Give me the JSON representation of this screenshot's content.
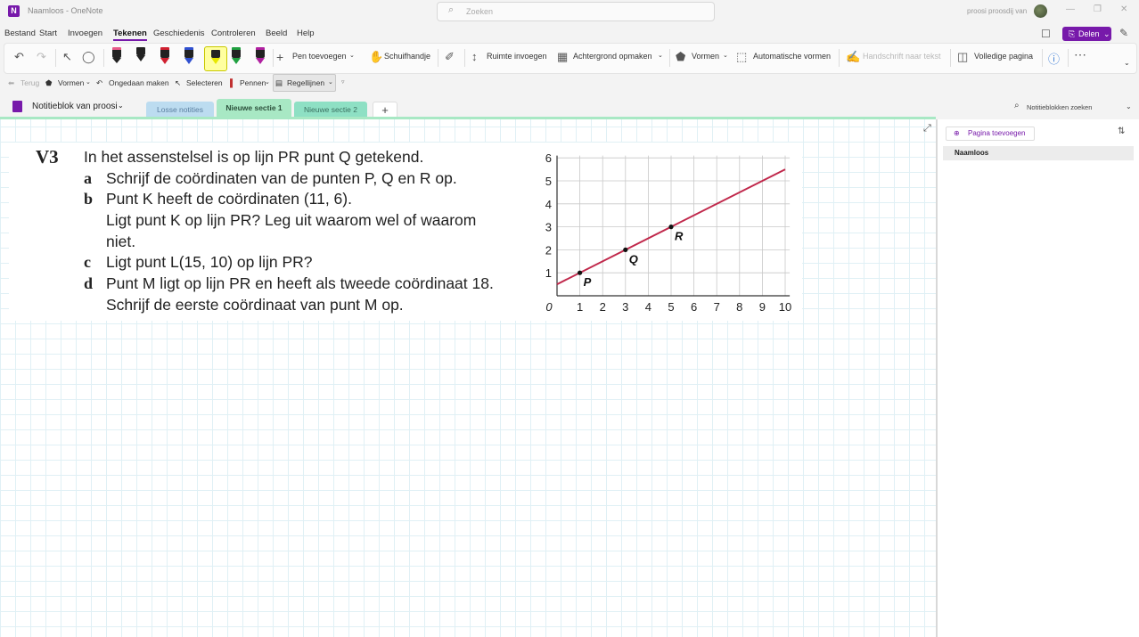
{
  "window": {
    "title": "Naamloos - OneNote",
    "user": "proosi proosdij van",
    "app_icon": "N"
  },
  "search": {
    "placeholder": "Zoeken"
  },
  "menu": [
    "Bestand",
    "Start",
    "Invoegen",
    "Tekenen",
    "Geschiedenis",
    "Controleren",
    "Beeld",
    "Help"
  ],
  "share_label": "Delen",
  "ribbon": {
    "add_pen": "Pen toevoegen",
    "hand": "Schuifhandje",
    "space": "Ruimte invoegen",
    "background": "Achtergrond opmaken",
    "shapes": "Vormen",
    "auto_shapes": "Automatische vormen",
    "ink_to_text": "Handschrift naar tekst",
    "full_page": "Volledige pagina"
  },
  "toolbar2": {
    "back": "Terug",
    "shapes": "Vormen",
    "undo": "Ongedaan maken",
    "select": "Selecteren",
    "pens": "Pennen",
    "rule_lines": "Regellijnen"
  },
  "notebook": {
    "name": "Notitieblok van proosi",
    "tabs": [
      "Losse notities",
      "Nieuwe sectie 1",
      "Nieuwe sectie 2"
    ],
    "add_tab": "+",
    "search_label": "Notitieblokken zoeken"
  },
  "pages": {
    "add_label": "Pagina toevoegen",
    "items": [
      "Naamloos"
    ]
  },
  "exercise": {
    "number": "V3",
    "intro": "In het assenstelsel is op lijn PR punt Q getekend.",
    "a_letter": "a",
    "a_text": "Schrijf de coördinaten van de punten P, Q en R op.",
    "b_letter": "b",
    "b_text1": "Punt K heeft de coördinaten (11, 6).",
    "b_text2": "Ligt punt K op lijn PR? Leg uit waarom wel of waarom",
    "b_text3": "niet.",
    "c_letter": "c",
    "c_text": "Ligt punt L(15, 10) op lijn PR?",
    "d_letter": "d",
    "d_text1": "Punt M ligt op lijn PR en heeft als tweede coördinaat 18.",
    "d_text2": "Schrijf de eerste coördinaat van punt M op."
  },
  "chart_data": {
    "type": "line",
    "title": "",
    "xlabel": "",
    "ylabel": "",
    "xlim": [
      0,
      10
    ],
    "ylim": [
      0,
      6
    ],
    "xticks": [
      "0",
      "1",
      "2",
      "3",
      "4",
      "5",
      "6",
      "7",
      "8",
      "9",
      "10"
    ],
    "yticks": [
      "1",
      "2",
      "3",
      "4",
      "5",
      "6"
    ],
    "grid": true,
    "line": {
      "x": [
        0,
        10
      ],
      "y": [
        0.5,
        5.5
      ],
      "color": "#c0284b"
    },
    "points": [
      {
        "label": "P",
        "x": 1,
        "y": 1
      },
      {
        "label": "Q",
        "x": 3,
        "y": 2
      },
      {
        "label": "R",
        "x": 5,
        "y": 3
      }
    ]
  }
}
